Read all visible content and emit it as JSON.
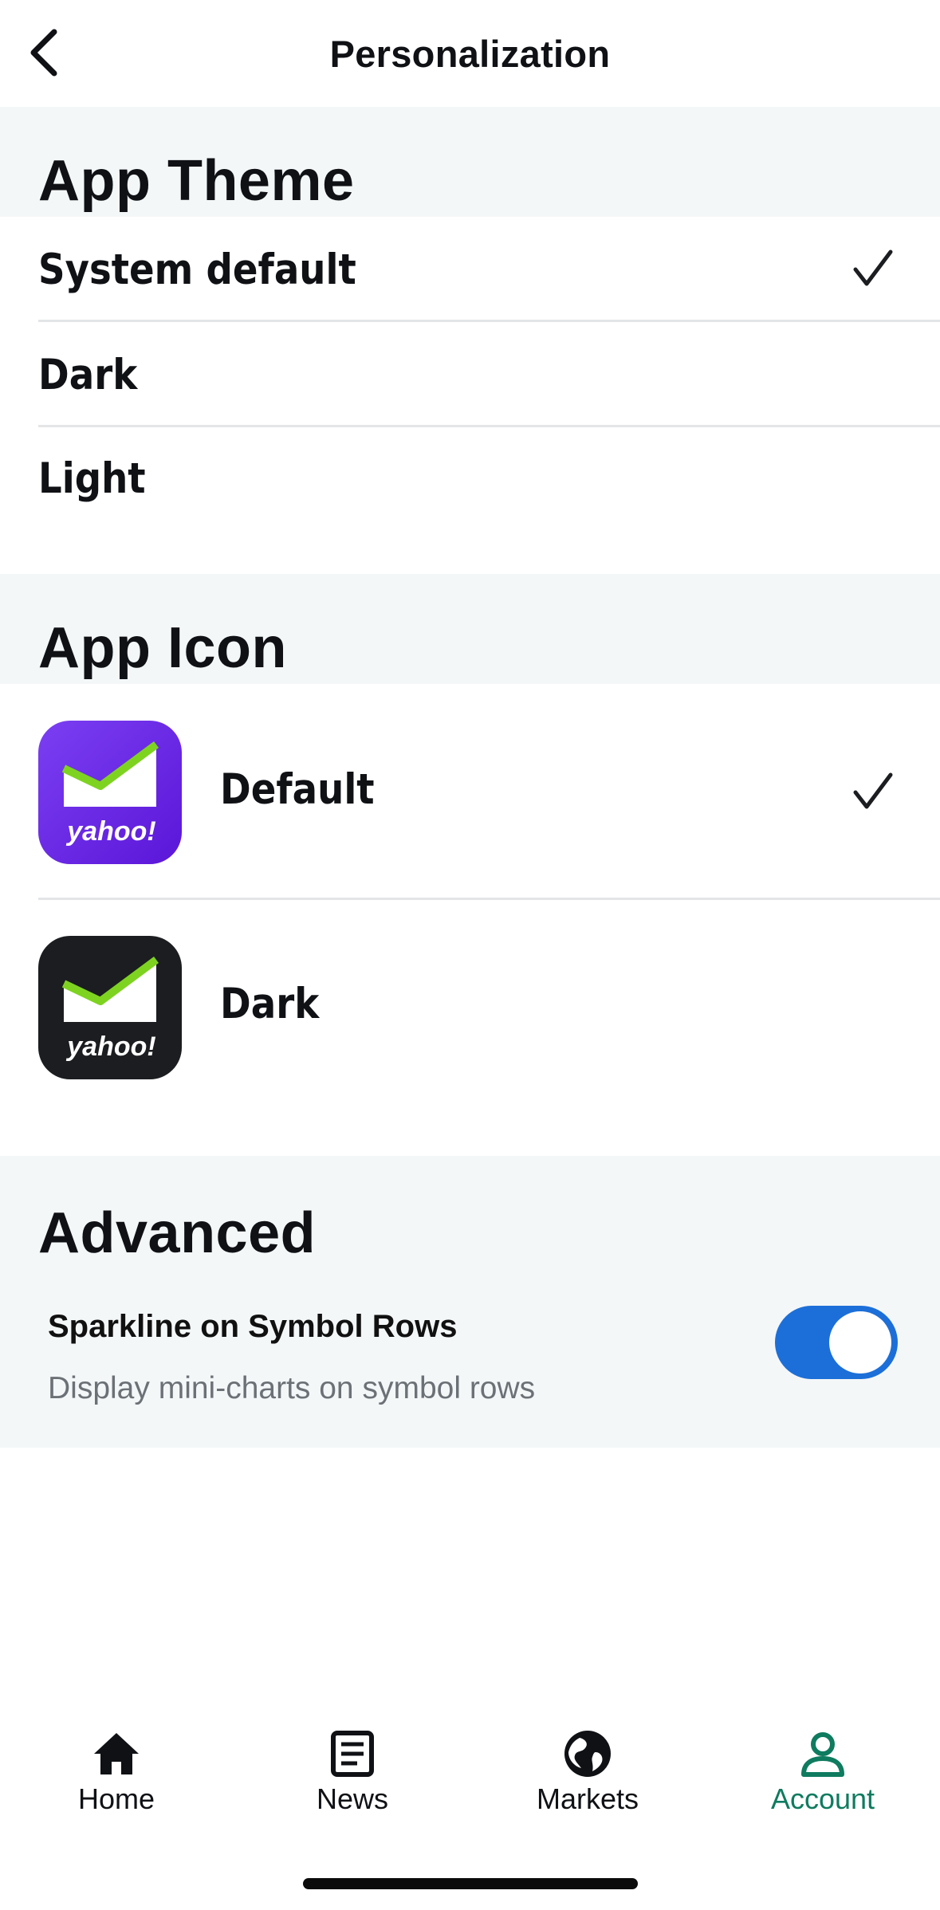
{
  "header": {
    "title": "Personalization",
    "back_icon": "chevron-left-icon"
  },
  "app_theme": {
    "heading": "App Theme",
    "options": [
      {
        "label": "System default",
        "selected": true
      },
      {
        "label": "Dark",
        "selected": false
      },
      {
        "label": "Light",
        "selected": false
      }
    ]
  },
  "app_icon": {
    "heading": "App Icon",
    "options": [
      {
        "label": "Default",
        "selected": true,
        "icon_text": "yahoo!",
        "icon_bg": "#6a25e6"
      },
      {
        "label": "Dark",
        "selected": false,
        "icon_text": "yahoo!",
        "icon_bg": "#1b1d20"
      }
    ]
  },
  "advanced": {
    "heading": "Advanced",
    "sparkline": {
      "title": "Sparkline on Symbol Rows",
      "subtitle": "Display mini-charts on symbol rows",
      "enabled": true
    }
  },
  "tabbar": {
    "tabs": [
      {
        "label": "Home",
        "icon": "home-icon",
        "active": false
      },
      {
        "label": "News",
        "icon": "news-icon",
        "active": false
      },
      {
        "label": "Markets",
        "icon": "globe-icon",
        "active": false
      },
      {
        "label": "Account",
        "icon": "account-icon",
        "active": true
      }
    ]
  },
  "colors": {
    "accent": "#0f7b5f",
    "toggle_on": "#1c6fd8",
    "section_bg": "#f4f7f8"
  }
}
